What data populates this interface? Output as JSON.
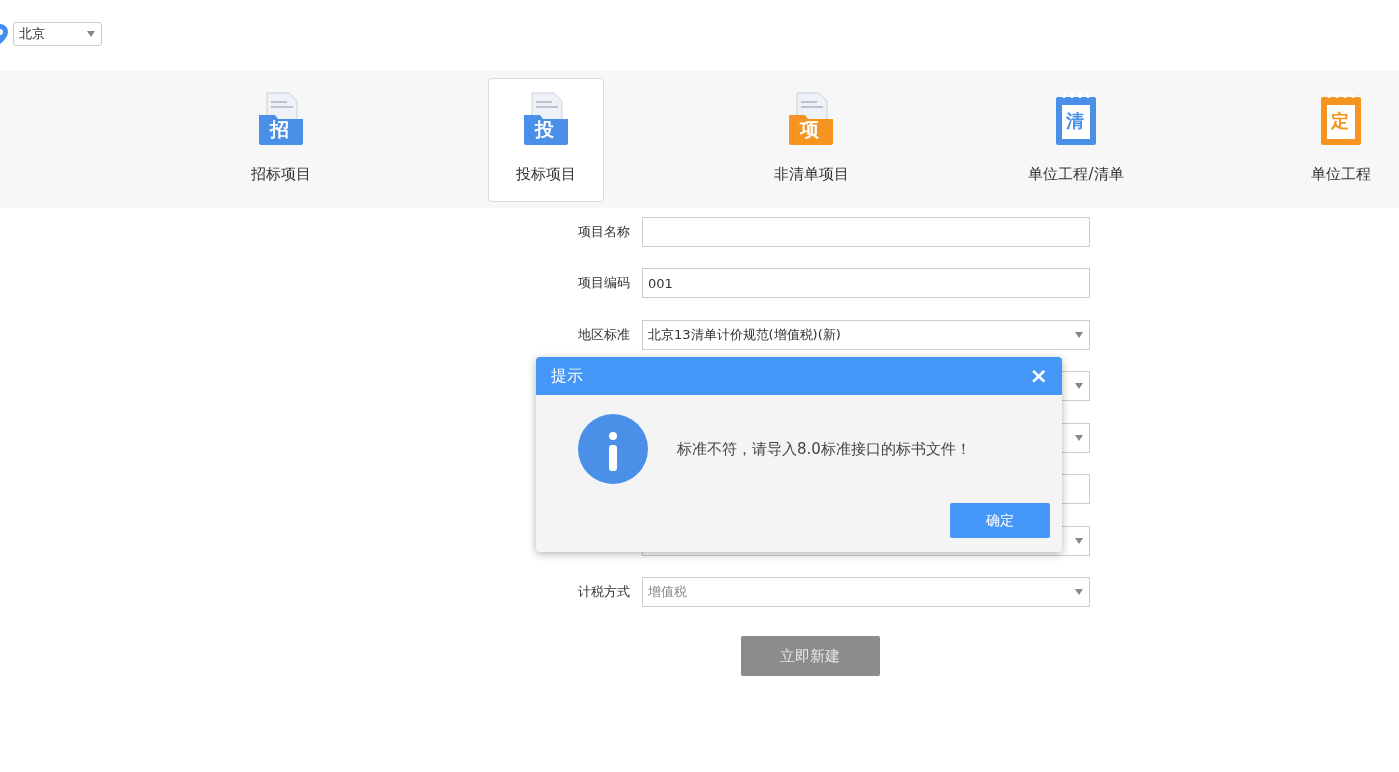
{
  "location": {
    "city": "北京"
  },
  "tabs": [
    {
      "label": "招标项目",
      "icon_char": "招",
      "kind": "folder",
      "color": "#4a90e8",
      "selected": false
    },
    {
      "label": "投标项目",
      "icon_char": "投",
      "kind": "folder",
      "color": "#4a90e8",
      "selected": true
    },
    {
      "label": "非清单项目",
      "icon_char": "项",
      "kind": "folder",
      "color": "#f59421",
      "selected": false
    },
    {
      "label": "单位工程/清单",
      "icon_char": "清",
      "kind": "notepad",
      "color": "#4a90e8",
      "selected": false
    },
    {
      "label": "单位工程",
      "icon_char": "定",
      "kind": "notepad",
      "color": "#f59421",
      "selected": false
    }
  ],
  "form": {
    "fields": [
      {
        "label": "项目名称",
        "kind": "input"
      },
      {
        "label": "项目编码",
        "kind": "input",
        "value": "001"
      },
      {
        "label": "地区标准",
        "kind": "select",
        "value": "北京13清单计价规范(增值税)(新)"
      },
      {
        "kind": "select"
      },
      {
        "kind": "select"
      },
      {
        "kind": "input"
      },
      {
        "kind": "select"
      },
      {
        "label": "计税方式",
        "kind": "select",
        "value": "增值税",
        "disabled": true
      }
    ],
    "submit": {
      "label": "立即新建",
      "disabled": true
    }
  },
  "dialog": {
    "title": "提示",
    "close": "×",
    "message": "标准不符，请导入8.0标准接口的标书文件！",
    "ok": "确定"
  }
}
